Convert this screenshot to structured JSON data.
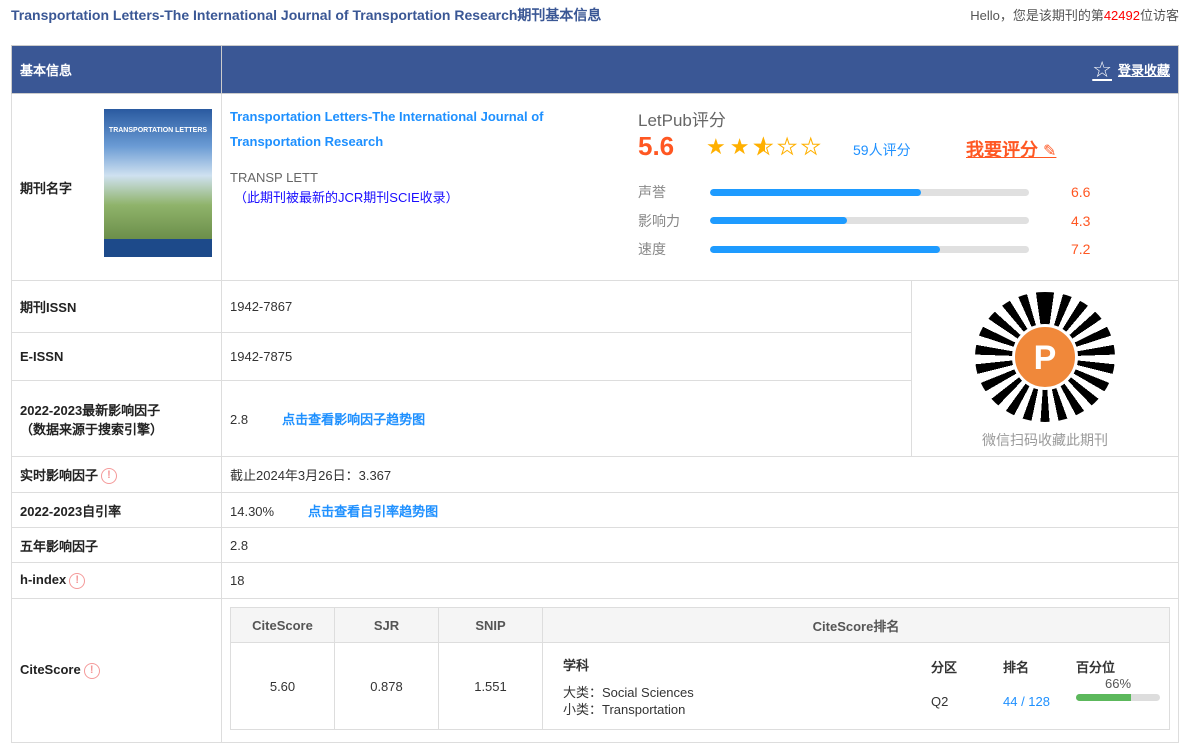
{
  "page_title": "Transportation Letters-The International Journal of Transportation Research期刊基本信息",
  "hello": {
    "prefix": "Hello，您是该期刊的第",
    "count": "42492",
    "suffix": "位访客"
  },
  "header": {
    "label": "基本信息",
    "fav_label": "登录收藏",
    "fav_icon": "star-outline-icon"
  },
  "journal": {
    "label": "期刊名字",
    "name": "Transportation Letters-The International Journal of Transportation Research",
    "abbr": "TRANSP LETT",
    "jcr_note": "（此期刊被最新的JCR期刊SCIE收录）",
    "cover_text": "TRANSPORTATION LETTERS"
  },
  "rating": {
    "title": "LetPub评分",
    "score": "5.6",
    "stars": 2.5,
    "count": "59人评分",
    "my_rate": "我要评分",
    "items": [
      {
        "label": "声誉",
        "value": "6.6",
        "fraction": 0.66
      },
      {
        "label": "影响力",
        "value": "4.3",
        "fraction": 0.43
      },
      {
        "label": "速度",
        "value": "7.2",
        "fraction": 0.72
      }
    ]
  },
  "issn": {
    "label": "期刊ISSN",
    "value": "1942-7867"
  },
  "eissn": {
    "label": "E-ISSN",
    "value": "1942-7875"
  },
  "if": {
    "label1": "2022-2023最新影响因子",
    "label2": "（数据来源于搜索引擎）",
    "value": "2.8",
    "link": "点击查看影响因子趋势图"
  },
  "qr": {
    "caption": "微信扫码收藏此期刊",
    "logo": "LetPub"
  },
  "realtime_if": {
    "label": "实时影响因子",
    "value": "截止2024年3月26日：3.367"
  },
  "self_cite": {
    "label": "2022-2023自引率",
    "value": "14.30%",
    "link": "点击查看自引率趋势图"
  },
  "five_year": {
    "label": "五年影响因子",
    "value": "2.8"
  },
  "hindex": {
    "label": "h-index",
    "value": "18"
  },
  "citescore": {
    "label": "CiteScore",
    "headers": [
      "CiteScore",
      "SJR",
      "SNIP",
      "CiteScore排名"
    ],
    "values": [
      "5.60",
      "0.878",
      "1.551"
    ],
    "rank": {
      "subject_h": "学科",
      "zone_h": "分区",
      "rank_h": "排名",
      "pct_h": "百分位",
      "major": "大类：Social Sciences",
      "minor": "小类：Transportation",
      "zone": "Q2",
      "rank": "44 / 128",
      "pct": "66%",
      "pct_value": 66
    }
  }
}
